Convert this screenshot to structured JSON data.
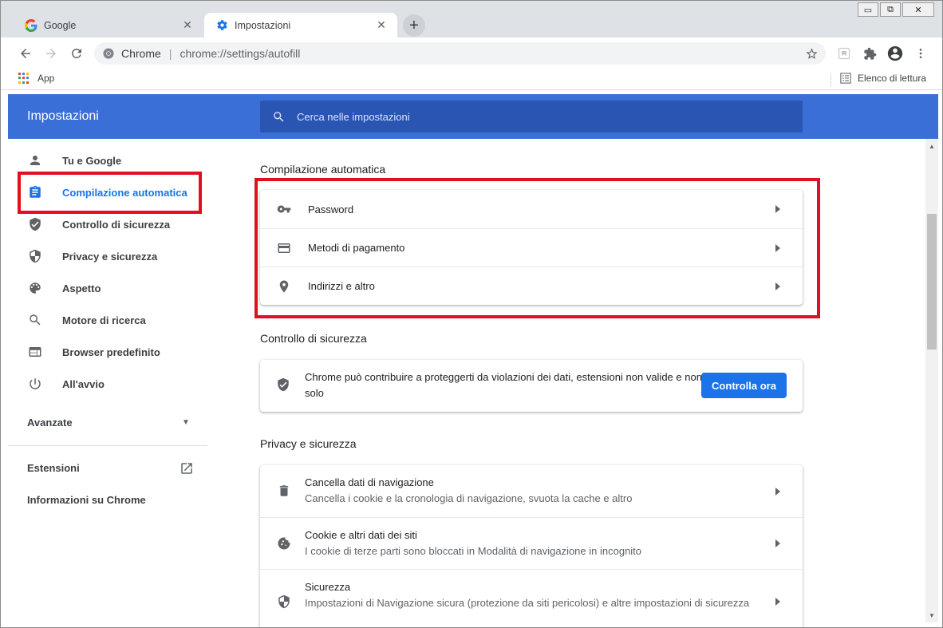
{
  "browser": {
    "tabs": [
      {
        "title": "Google",
        "active": false
      },
      {
        "title": "Impostazioni",
        "active": true
      }
    ],
    "new_tab_symbol": "+",
    "close_symbol": "✕",
    "window_controls": {
      "minimize": "▭",
      "restore": "⧉",
      "close": "✕"
    },
    "omnibox": {
      "site_label": "Chrome",
      "separator": "|",
      "url": "chrome://settings/autofill"
    },
    "bookmarks": {
      "apps_label": "App",
      "reading_list_label": "Elenco di lettura"
    }
  },
  "settings": {
    "header_title": "Impostazioni",
    "search_placeholder": "Cerca nelle impostazioni",
    "sidebar": {
      "items": [
        {
          "label": "Tu e Google",
          "icon": "person-icon",
          "selected": false
        },
        {
          "label": "Compilazione automatica",
          "icon": "clipboard-icon",
          "selected": true
        },
        {
          "label": "Controllo di sicurezza",
          "icon": "shield-check-icon",
          "selected": false
        },
        {
          "label": "Privacy e sicurezza",
          "icon": "shield-half-icon",
          "selected": false
        },
        {
          "label": "Aspetto",
          "icon": "palette-icon",
          "selected": false
        },
        {
          "label": "Motore di ricerca",
          "icon": "search-icon",
          "selected": false
        },
        {
          "label": "Browser predefinito",
          "icon": "browser-icon",
          "selected": false
        },
        {
          "label": "All'avvio",
          "icon": "power-icon",
          "selected": false
        }
      ],
      "advanced_label": "Avanzate",
      "extensions_label": "Estensioni",
      "about_label": "Informazioni su Chrome"
    },
    "sections": {
      "autofill": {
        "title": "Compilazione automatica",
        "rows": [
          {
            "label": "Password",
            "icon": "key-icon"
          },
          {
            "label": "Metodi di pagamento",
            "icon": "credit-card-icon"
          },
          {
            "label": "Indirizzi e altro",
            "icon": "location-pin-icon"
          }
        ]
      },
      "safety_check": {
        "title": "Controllo di sicurezza",
        "text": "Chrome può contribuire a proteggerti da violazioni dei dati, estensioni non valide e non solo",
        "button_label": "Controlla ora"
      },
      "privacy": {
        "title": "Privacy e sicurezza",
        "rows": [
          {
            "title": "Cancella dati di navigazione",
            "subtitle": "Cancella i cookie e la cronologia di navigazione, svuota la cache e altro",
            "icon": "trash-icon"
          },
          {
            "title": "Cookie e altri dati dei siti",
            "subtitle": "I cookie di terze parti sono bloccati in Modalità di navigazione in incognito",
            "icon": "cookie-icon"
          },
          {
            "title": "Sicurezza",
            "subtitle": "Impostazioni di Navigazione sicura (protezione da siti pericolosi) e altre impostazioni di sicurezza",
            "icon": "shield-half-icon"
          }
        ]
      }
    }
  },
  "colors": {
    "header_blue": "#3b6fd8",
    "accent_blue": "#1a73e8",
    "highlight_red": "#e0101e"
  }
}
